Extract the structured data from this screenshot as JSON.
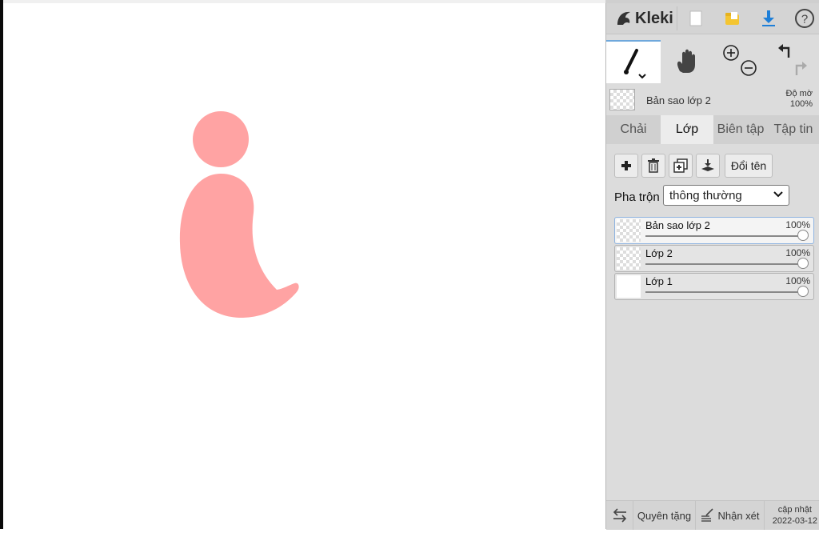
{
  "app": {
    "name": "Kleki"
  },
  "header": {
    "logo_text": "Kleki",
    "icons": [
      "new-document-icon",
      "open-folder-icon",
      "download-icon",
      "help-icon"
    ],
    "accent": "#1e7fd8",
    "folder_color": "#f4c531"
  },
  "tools": [
    "brush-icon",
    "hand-icon",
    "zoom-in-icon",
    "zoom-out-icon",
    "undo-icon",
    "redo-icon"
  ],
  "current_layer": {
    "name": "Bản sao lớp 2",
    "opacity_label": "Độ mờ",
    "opacity_value": "100%"
  },
  "tabs": [
    {
      "label": "Chải"
    },
    {
      "label": "Lớp",
      "active": true
    },
    {
      "label": "Biên tập"
    },
    {
      "label": "Tập tin"
    }
  ],
  "layer_tools": {
    "icons": [
      "add-layer-icon",
      "delete-layer-icon",
      "duplicate-layer-icon",
      "merge-down-icon"
    ],
    "rename_label": "Đổi tên"
  },
  "blend": {
    "label": "Pha trộn",
    "value": "thông thường"
  },
  "layers": [
    {
      "name": "Bản sao lớp 2",
      "opacity": "100%",
      "selected": true
    },
    {
      "name": "Lớp 2",
      "opacity": "100%",
      "selected": false
    },
    {
      "name": "Lớp 1",
      "opacity": "100%",
      "selected": false
    }
  ],
  "footer": {
    "donate_label": "Quyên tặng",
    "feedback_label": "Nhận xét",
    "update_label": "cập nhật",
    "update_date": "2022-03-12"
  },
  "canvas": {
    "shape_color": "#ffa3a3",
    "background": "#ffffff"
  }
}
